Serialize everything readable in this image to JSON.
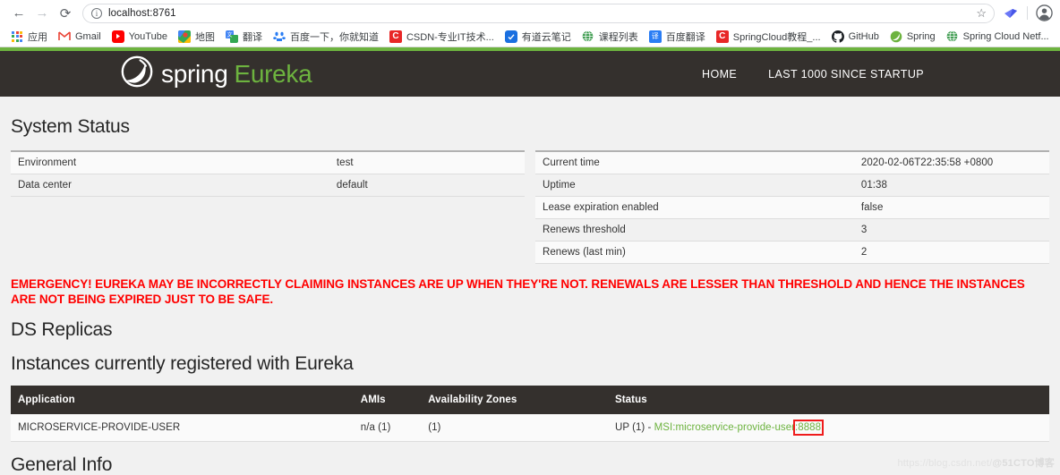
{
  "browser": {
    "back_icon": "←",
    "forward_icon": "→",
    "reload_icon": "⟳",
    "site_info_icon": "ⓘ",
    "url": "localhost:8761",
    "url_placeholder": "Search Google or type a URL",
    "star_icon": "☆",
    "extension_icon": "extension-icon",
    "profile_icon": "profile-avatar-icon",
    "bookmarks": [
      {
        "label": "应用",
        "icon": "apps-grid-icon"
      },
      {
        "label": "Gmail",
        "icon": "gmail-icon"
      },
      {
        "label": "YouTube",
        "icon": "youtube-icon"
      },
      {
        "label": "地图",
        "icon": "google-maps-icon"
      },
      {
        "label": "翻译",
        "icon": "google-translate-icon"
      },
      {
        "label": "百度一下，你就知道",
        "icon": "baidu-icon"
      },
      {
        "label": "CSDN-专业IT技术...",
        "icon": "csdn-icon"
      },
      {
        "label": "有道云笔记",
        "icon": "youdao-icon"
      },
      {
        "label": "课程列表",
        "icon": "globe-icon"
      },
      {
        "label": "百度翻译",
        "icon": "baidu-fanyi-icon"
      },
      {
        "label": "SpringCloud教程_...",
        "icon": "csdn-icon"
      },
      {
        "label": "GitHub",
        "icon": "github-icon"
      },
      {
        "label": "Spring",
        "icon": "spring-leaf-icon"
      },
      {
        "label": "Spring Cloud Netf...",
        "icon": "globe-icon"
      }
    ]
  },
  "navbar": {
    "brand_spring": "spring",
    "brand_eureka": "Eureka",
    "logo_icon": "spring-leaf-logo",
    "links": [
      {
        "label": "HOME"
      },
      {
        "label": "LAST 1000 SINCE STARTUP"
      }
    ]
  },
  "system_status": {
    "heading": "System Status",
    "left_rows": [
      {
        "key": "Environment",
        "value": "test"
      },
      {
        "key": "Data center",
        "value": "default"
      }
    ],
    "right_rows": [
      {
        "key": "Current time",
        "value": "2020-02-06T22:35:58 +0800"
      },
      {
        "key": "Uptime",
        "value": "01:38"
      },
      {
        "key": "Lease expiration enabled",
        "value": "false"
      },
      {
        "key": "Renews threshold",
        "value": "3"
      },
      {
        "key": "Renews (last min)",
        "value": "2"
      }
    ]
  },
  "emergency": {
    "message": "EMERGENCY! EUREKA MAY BE INCORRECTLY CLAIMING INSTANCES ARE UP WHEN THEY'RE NOT. RENEWALS ARE LESSER THAN THRESHOLD AND HENCE THE INSTANCES ARE NOT BEING EXPIRED JUST TO BE SAFE.",
    "color": "#ff0000"
  },
  "ds_replicas": {
    "heading": "DS Replicas"
  },
  "instances": {
    "heading": "Instances currently registered with Eureka",
    "columns": [
      "Application",
      "AMIs",
      "Availability Zones",
      "Status"
    ],
    "rows": [
      {
        "application": "MICROSERVICE-PROVIDE-USER",
        "amis": "n/a (1)",
        "zones": "(1)",
        "status_prefix": "UP (1) - ",
        "status_link_main": "MSI:microservice-provide-user",
        "status_link_port": ":8888",
        "link_color": "#6db33f",
        "highlight_color": "#ef1c1c"
      }
    ]
  },
  "general_info": {
    "heading": "General Info"
  },
  "watermark": {
    "url": "https://blog.csdn.net/",
    "tag": "@51CTO博客"
  }
}
